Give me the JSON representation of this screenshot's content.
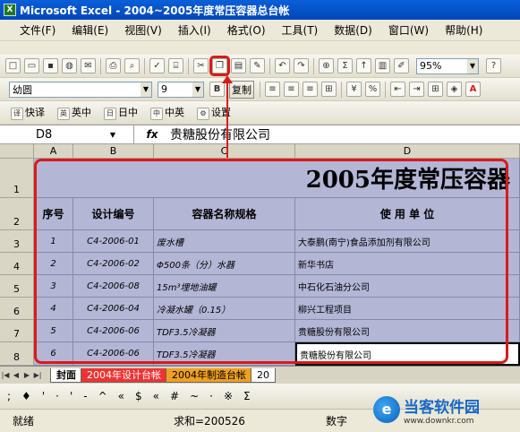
{
  "window": {
    "title": "Microsoft Excel - 2004~2005年度常压容器总台帐",
    "app_icon": "X"
  },
  "menu": [
    "文件(F)",
    "编辑(E)",
    "视图(V)",
    "插入(I)",
    "格式(O)",
    "工具(T)",
    "数据(D)",
    "窗口(W)",
    "帮助(H)"
  ],
  "standard_toolbar": {
    "zoom": "95%",
    "sigma": "Σ"
  },
  "format_toolbar": {
    "font": "幼圆",
    "size": "9",
    "bold": "B",
    "copy_label": "复制",
    "font_color_letter": "A"
  },
  "translate_toolbar": {
    "items": [
      "快译",
      "英中",
      "日中",
      "中英",
      "设置"
    ]
  },
  "formula_bar": {
    "cell_ref": "D8",
    "fx": "fx",
    "content": "贵糖股份有限公司"
  },
  "columns": [
    "A",
    "B",
    "C",
    "D"
  ],
  "rows": [
    "1",
    "2",
    "3",
    "4",
    "5",
    "6",
    "7",
    "8"
  ],
  "sheet": {
    "title": "2005年度常压容器",
    "headers": {
      "no": "序号",
      "code": "设计编号",
      "name": "容器名称规格",
      "unit": "使   用   单   位"
    },
    "records": [
      {
        "no": "1",
        "code": "C4-2006-01",
        "name": "废水槽",
        "unit": "大泰鹏(南宁)食品添加剂有限公司"
      },
      {
        "no": "2",
        "code": "C4-2006-02",
        "name": "Φ500条（分）水器",
        "unit": "新华书店"
      },
      {
        "no": "3",
        "code": "C4-2006-08",
        "name": "15m³埋地油罐",
        "unit": "中石化石油分公司"
      },
      {
        "no": "4",
        "code": "C4-2006-04",
        "name": "冷凝水罐（0.15）",
        "unit": "柳兴工程项目"
      },
      {
        "no": "5",
        "code": "C4-2006-06",
        "name": "TDF3.5冷凝器",
        "unit": "贵糖股份有限公司"
      },
      {
        "no": "6",
        "code": "C4-2006-06",
        "name": "TDF3.5冷凝器",
        "unit": "贵糖股份有限公司"
      }
    ]
  },
  "tabs": [
    "封面",
    "2004年设计台帐",
    "2004年制造台帐",
    "20"
  ],
  "drawing_toolbar": [
    ";",
    "♦",
    "'",
    "·",
    "'",
    "-",
    "^",
    "«",
    "$",
    "«",
    "#",
    "~",
    "·",
    "※",
    "Σ"
  ],
  "status": {
    "ready": "就绪",
    "sum": "求和=200526",
    "mode": "数字"
  },
  "watermark": {
    "logo": "e",
    "name": "当客软件园",
    "url": "www.downkr.com"
  },
  "colors": {
    "title_bar": "#0a5fd8",
    "cell_fill": "#b4b6d6",
    "highlight": "#d81b1b"
  }
}
